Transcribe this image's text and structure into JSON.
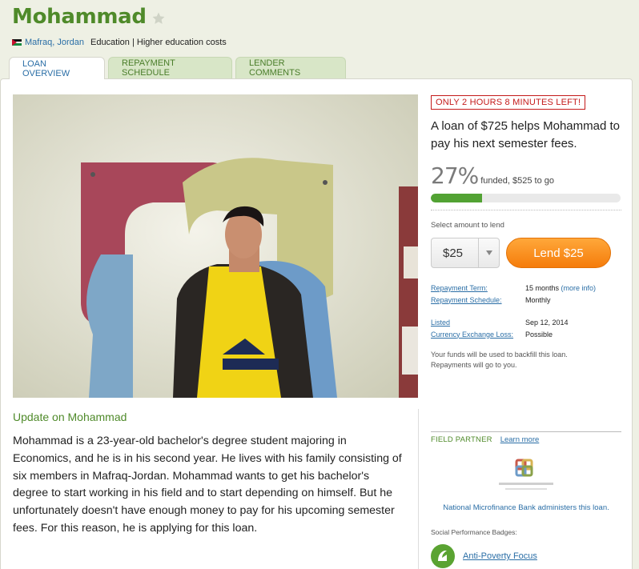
{
  "borrower": {
    "name": "Mohammad",
    "location": "Mafraq, Jordan",
    "sector": "Education | Higher education costs"
  },
  "tabs": [
    {
      "label": "LOAN OVERVIEW",
      "active": true
    },
    {
      "label": "REPAYMENT SCHEDULE",
      "active": false
    },
    {
      "label": "LENDER COMMENTS",
      "active": false
    }
  ],
  "loan": {
    "countdown": "ONLY 2 HOURS 8 MINUTES LEFT!",
    "headline": "A loan of $725 helps Mohammad to pay his next semester fees.",
    "funded_pct": "27%",
    "funded_text": "funded, $525 to go",
    "progress_fraction": 0.27,
    "select_label": "Select amount to lend",
    "amount": "$25",
    "lend_button": "Lend $25"
  },
  "terms": [
    {
      "key": "Repayment Term:",
      "value": "15 months",
      "extra": "(more info)"
    },
    {
      "key": "Repayment Schedule:",
      "value": "Monthly"
    },
    {
      "key": "Listed",
      "value": "Sep 12, 2014"
    },
    {
      "key": "Currency Exchange Loss:",
      "value": "Possible"
    }
  ],
  "funds_note": [
    "Your funds will be used to backfill this loan.",
    "Repayments will go to you."
  ],
  "update": {
    "title": "Update on Mohammad",
    "story": "Mohammad is a 23-year-old bachelor's degree student majoring in Economics, and he is in his second year. He lives with his family consisting of six members in Mafraq-Jordan. Mohammad wants to get his bachelor's degree to start working in his field and to start depending on himself. But he unfortunately doesn't have enough money to pay for his upcoming semester fees. For this reason, he is applying for this loan."
  },
  "partner": {
    "label": "FIELD PARTNER",
    "learn_more": "Learn more",
    "admin_text": "National Microfinance Bank administers this loan.",
    "badges_label": "Social Performance Badges:",
    "badge": "Anti-Poverty Focus"
  },
  "colors": {
    "brand_green": "#4f8a2a",
    "link_blue": "#2a6ea6",
    "alert_red": "#c41a1a",
    "lend_orange": "#f57c0b",
    "progress_green": "#52a233"
  }
}
